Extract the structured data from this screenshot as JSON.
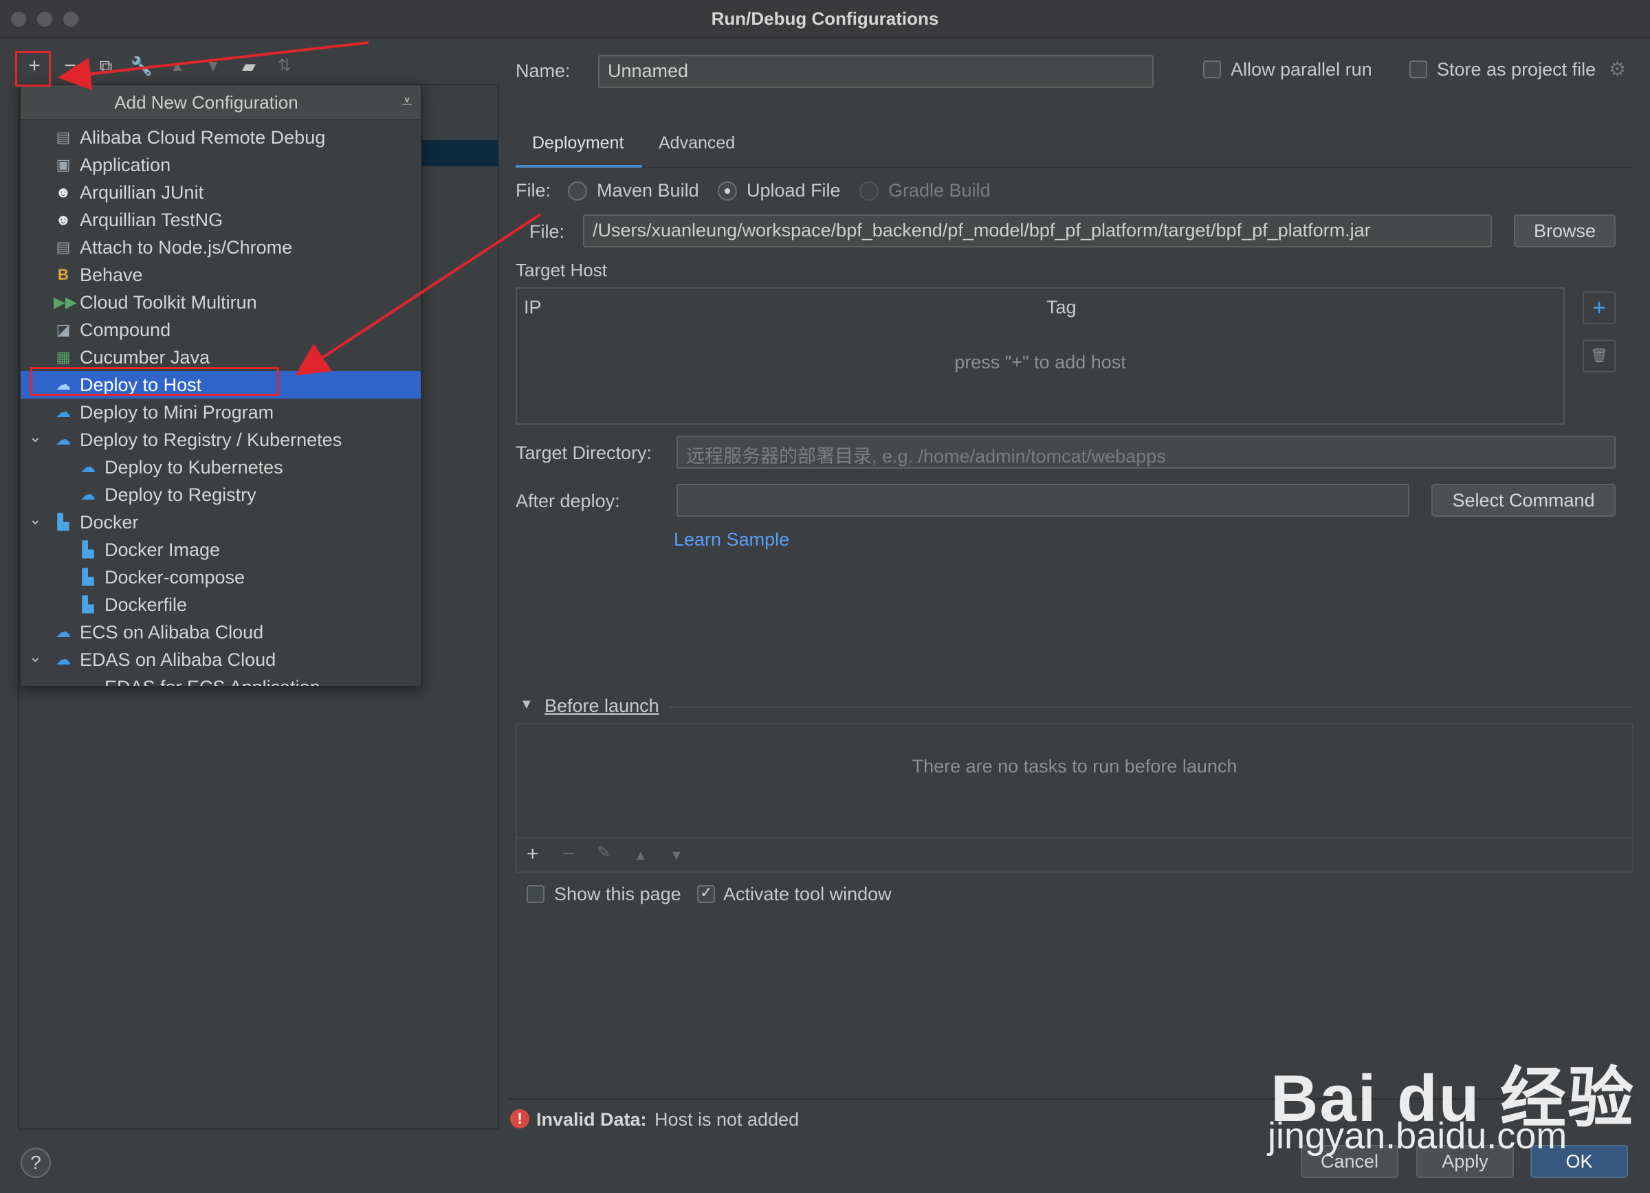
{
  "window": {
    "title": "Run/Debug Configurations"
  },
  "popup": {
    "title": "Add New Configuration",
    "items": [
      {
        "label": "Alibaba Cloud Remote Debug",
        "icon": "remote-debug-icon"
      },
      {
        "label": "Application",
        "icon": "application-icon"
      },
      {
        "label": "Arquillian JUnit",
        "icon": "arquillian-icon"
      },
      {
        "label": "Arquillian TestNG",
        "icon": "arquillian-icon"
      },
      {
        "label": "Attach to Node.js/Chrome",
        "icon": "nodejs-icon"
      },
      {
        "label": "Behave",
        "icon": "behave-icon"
      },
      {
        "label": "Cloud Toolkit Multirun",
        "icon": "multirun-icon"
      },
      {
        "label": "Compound",
        "icon": "compound-icon"
      },
      {
        "label": "Cucumber Java",
        "icon": "cucumber-icon"
      },
      {
        "label": "Deploy to Host",
        "icon": "cloud-deploy-icon",
        "selected": true
      },
      {
        "label": "Deploy to Mini Program",
        "icon": "cloud-deploy-icon"
      },
      {
        "label": "Deploy to Registry / Kubernetes",
        "icon": "cloud-deploy-icon",
        "expanded": true
      },
      {
        "label": "Deploy to Kubernetes",
        "icon": "cloud-deploy-icon"
      },
      {
        "label": "Deploy to Registry",
        "icon": "cloud-deploy-icon"
      },
      {
        "label": "Docker",
        "icon": "docker-icon",
        "expanded": true
      },
      {
        "label": "Docker Image",
        "icon": "docker-icon"
      },
      {
        "label": "Docker-compose",
        "icon": "docker-icon"
      },
      {
        "label": "Dockerfile",
        "icon": "docker-icon"
      },
      {
        "label": "ECS on Alibaba Cloud",
        "icon": "cloud-deploy-icon"
      },
      {
        "label": "EDAS on Alibaba Cloud",
        "icon": "cloud-deploy-icon",
        "expanded": true
      },
      {
        "label": "EDAS for ECS Application",
        "icon": "cloud-deploy-icon"
      }
    ]
  },
  "form": {
    "name_label": "Name:",
    "name_value": "Unnamed",
    "allow_parallel_label": "Allow parallel run",
    "store_project_label": "Store as project file",
    "tabs": [
      "Deployment",
      "Advanced"
    ],
    "file_label": "File:",
    "file_options": [
      "Maven Build",
      "Upload File",
      "Gradle Build"
    ],
    "file_selected": "Upload File",
    "file_path_label": "File:",
    "file_path": "/Users/xuanleung/workspace/bpf_backend/pf_model/bpf_pf_platform/target/bpf_pf_platform.jar",
    "browse_label": "Browse",
    "target_host_label": "Target Host",
    "host_columns": [
      "IP",
      "Tag"
    ],
    "host_empty": "press \"+\" to add host",
    "target_dir_label": "Target Directory:",
    "target_dir_placeholder": "远程服务器的部署目录, e.g. /home/admin/tomcat/webapps",
    "after_deploy_label": "After deploy:",
    "after_deploy_value": "",
    "select_command_label": "Select Command",
    "learn_sample_label": "Learn Sample",
    "before_launch_label": "Before launch",
    "before_launch_empty": "There are no tasks to run before launch",
    "show_page_label": "Show this page",
    "show_page_checked": false,
    "activate_tool_label": "Activate tool window",
    "activate_tool_checked": true,
    "error_bold": "Invalid Data:",
    "error_text": "Host is not added"
  },
  "footer": {
    "cancel_label": "Cancel",
    "apply_label": "Apply",
    "ok_label": "OK",
    "help_label": "?"
  },
  "watermark": {
    "logo": "Bai du 经验",
    "url": "jingyan.baidu.com"
  },
  "colors": {
    "accent": "#2f65ca",
    "link": "#589df6",
    "annotation": "#e0262c",
    "error": "#d64a44"
  }
}
